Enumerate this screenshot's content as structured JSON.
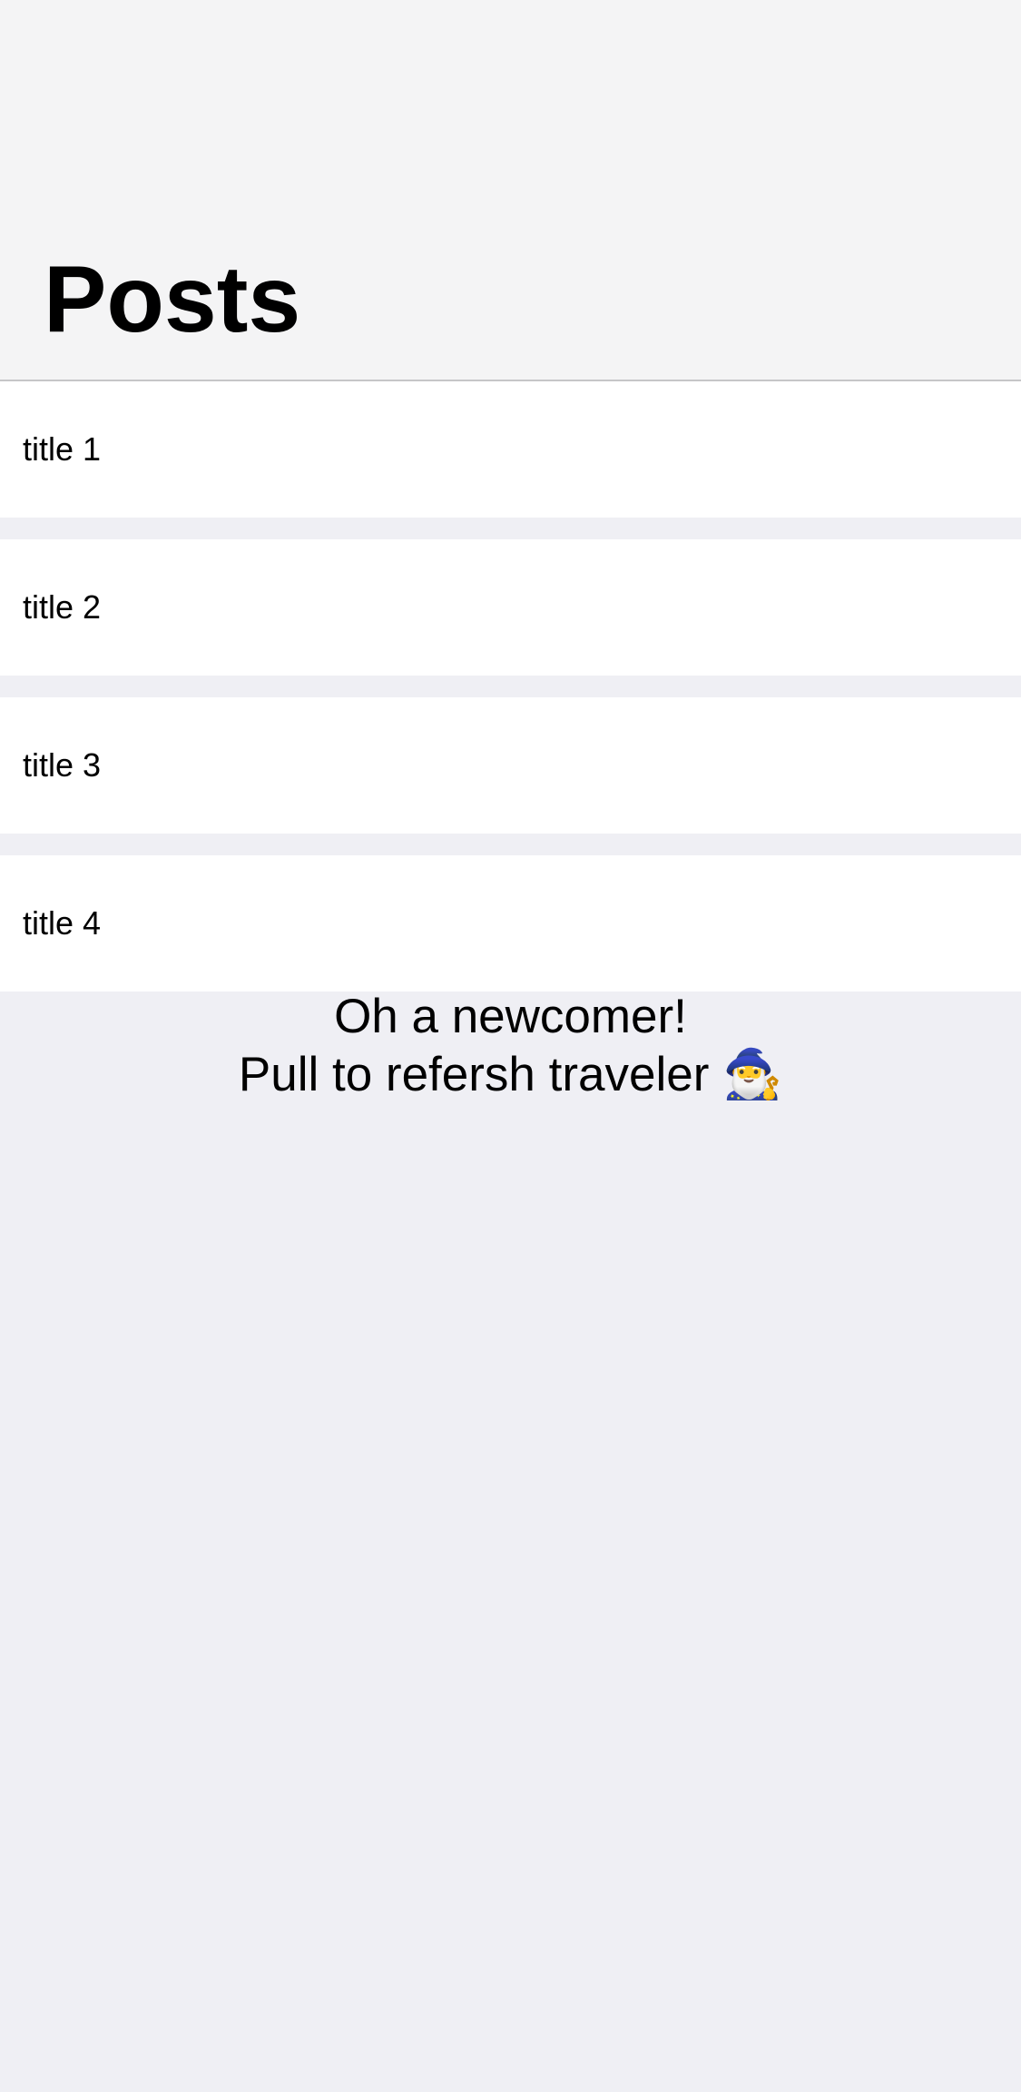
{
  "header": {
    "title": "Posts"
  },
  "posts": [
    {
      "title": "title 1"
    },
    {
      "title": "title 2"
    },
    {
      "title": "title 3"
    },
    {
      "title": "title 4"
    }
  ],
  "empty_state": {
    "line1": "Oh a newcomer!",
    "line2": "Pull to refersh traveler",
    "emoji": "🧙‍♂️",
    "emoji_icon": "wizard-icon"
  },
  "colors": {
    "background": "#efeff4",
    "header_background": "#f4f4f5",
    "row_background": "#ffffff",
    "separator": "#c6c6c8"
  }
}
